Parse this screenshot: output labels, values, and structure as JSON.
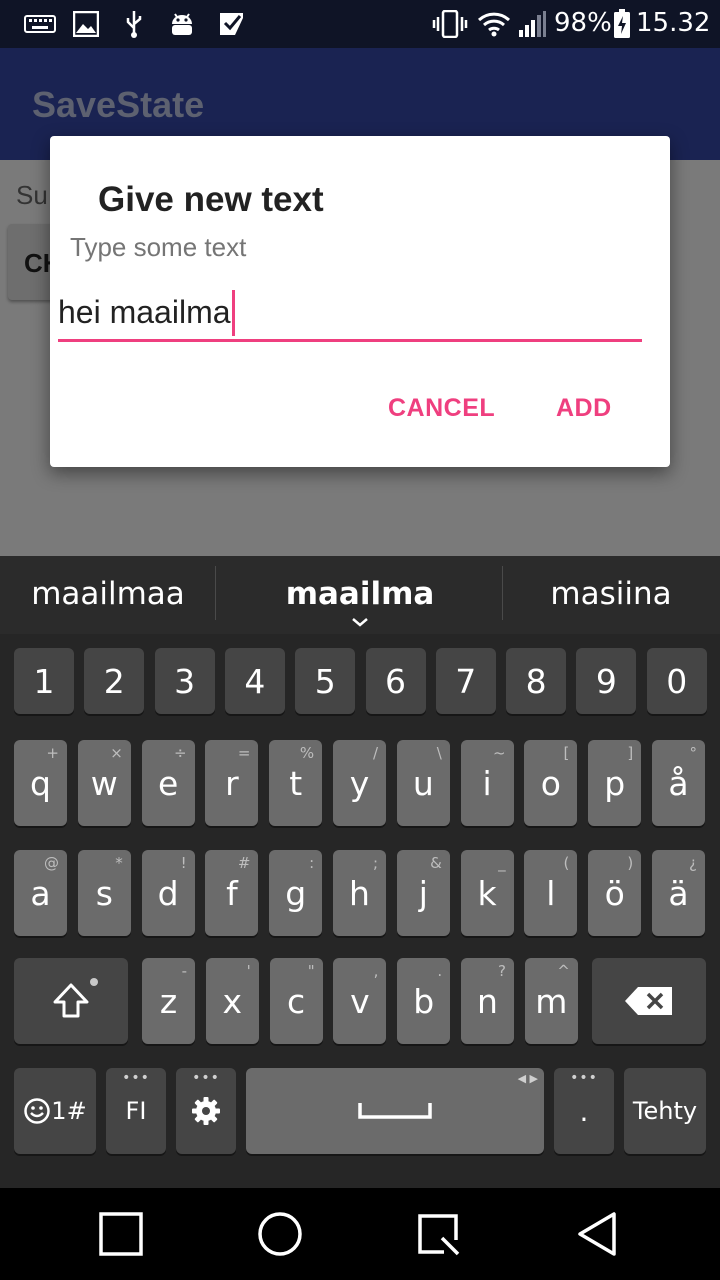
{
  "status_bar": {
    "battery_percent": "98%",
    "time": "15.32",
    "icons": [
      "keyboard-icon",
      "image-icon",
      "usb-icon",
      "android-debug-icon",
      "checkbox-icon",
      "vibrate-icon",
      "wifi-icon",
      "signal-icon",
      "battery-charging-icon"
    ]
  },
  "app": {
    "title": "SaveState",
    "body_label": "Su",
    "body_button_label": "CH"
  },
  "dialog": {
    "title": "Give new text",
    "message": "Type some text",
    "input_value": "hei maailma",
    "cancel_label": "CANCEL",
    "add_label": "ADD",
    "accent_color": "#ef3f7f"
  },
  "keyboard": {
    "suggestions": [
      "maailmaa",
      "maailma",
      "masiina"
    ],
    "number_row": [
      "1",
      "2",
      "3",
      "4",
      "5",
      "6",
      "7",
      "8",
      "9",
      "0"
    ],
    "row1": [
      {
        "key": "q",
        "hint": "+"
      },
      {
        "key": "w",
        "hint": "×"
      },
      {
        "key": "e",
        "hint": "÷"
      },
      {
        "key": "r",
        "hint": "="
      },
      {
        "key": "t",
        "hint": "%"
      },
      {
        "key": "y",
        "hint": "/"
      },
      {
        "key": "u",
        "hint": "\\"
      },
      {
        "key": "i",
        "hint": "~"
      },
      {
        "key": "o",
        "hint": "["
      },
      {
        "key": "p",
        "hint": "]"
      },
      {
        "key": "å",
        "hint": "°"
      }
    ],
    "row2": [
      {
        "key": "a",
        "hint": "@"
      },
      {
        "key": "s",
        "hint": "*"
      },
      {
        "key": "d",
        "hint": "!"
      },
      {
        "key": "f",
        "hint": "#"
      },
      {
        "key": "g",
        "hint": ":"
      },
      {
        "key": "h",
        "hint": ";"
      },
      {
        "key": "j",
        "hint": "&"
      },
      {
        "key": "k",
        "hint": "_"
      },
      {
        "key": "l",
        "hint": "("
      },
      {
        "key": "ö",
        "hint": ")"
      },
      {
        "key": "ä",
        "hint": "¿"
      }
    ],
    "row3": [
      {
        "key": "z",
        "hint": "-"
      },
      {
        "key": "x",
        "hint": "'"
      },
      {
        "key": "c",
        "hint": "\""
      },
      {
        "key": "v",
        "hint": ","
      },
      {
        "key": "b",
        "hint": "."
      },
      {
        "key": "n",
        "hint": "?"
      },
      {
        "key": "m",
        "hint": "^"
      }
    ],
    "emoji_key_label": "1#",
    "language_key_label": "FI",
    "period_key_label": ".",
    "enter_key_label": "Tehty"
  },
  "nav_bar": {
    "buttons": [
      "recents-square-icon",
      "home-circle-icon",
      "screenshot-icon",
      "back-triangle-icon"
    ]
  }
}
